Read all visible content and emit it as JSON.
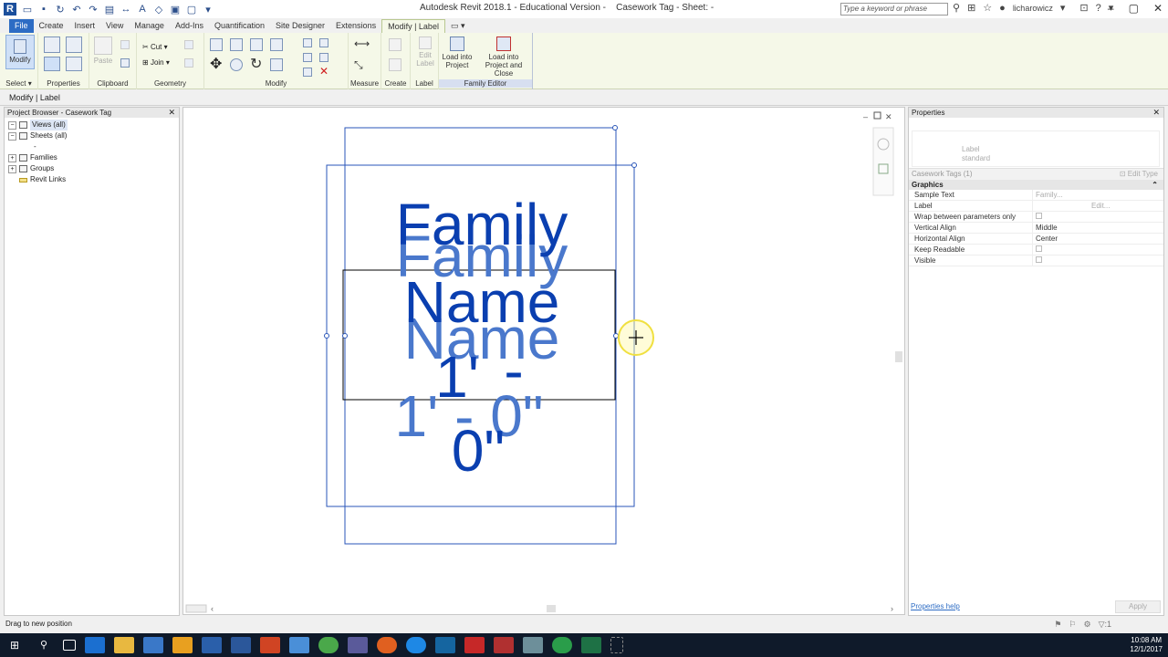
{
  "title_bar": {
    "app_title": "Autodesk Revit 2018.1 - Educational Version -",
    "doc_title": "Casework Tag - Sheet: -",
    "search_placeholder": "Type a keyword or phrase",
    "user": "licharowicz"
  },
  "tabs": [
    "File",
    "Create",
    "Insert",
    "View",
    "Manage",
    "Add-Ins",
    "Quantification",
    "Site Designer",
    "Extensions",
    "Modify | Label"
  ],
  "ribbon": {
    "panels": {
      "select": "Select",
      "properties": "Properties",
      "clipboard": "Clipboard",
      "geometry": "Geometry",
      "modify": "Modify",
      "measure": "Measure",
      "create": "Create",
      "label": "Label",
      "family_editor": "Family Editor"
    },
    "buttons": {
      "modify": "Modify",
      "paste": "Paste",
      "cut": "Cut",
      "join": "Join",
      "edit_label_1": "Edit",
      "edit_label_2": "Label",
      "load_project_1": "Load into",
      "load_project_2": "Project",
      "load_close_1": "Load into",
      "load_close_2": "Project and Close"
    }
  },
  "options_bar": {
    "context": "Modify | Label"
  },
  "project_browser": {
    "title": "Project Browser - Casework Tag",
    "items": [
      {
        "label": "Views (all)",
        "level": 0,
        "toggle": "−"
      },
      {
        "label": "Sheets (all)",
        "level": 0,
        "toggle": "−"
      },
      {
        "label": "-",
        "level": 1,
        "toggle": ""
      },
      {
        "label": "Families",
        "level": 0,
        "toggle": "+"
      },
      {
        "label": "Groups",
        "level": 0,
        "toggle": "+"
      },
      {
        "label": "Revit Links",
        "level": 0,
        "toggle": ""
      }
    ]
  },
  "canvas": {
    "label_text": {
      "line1": "Family",
      "line2": "Name",
      "line3": "1'",
      "line4": "-",
      "line5": "0\""
    },
    "ghost_text": {
      "line1": "Family",
      "line2": "Name",
      "line3": "1' - 0\""
    }
  },
  "properties": {
    "title": "Properties",
    "type_name_line1": "Label",
    "type_name_line2": "standard",
    "instance": "Casework Tags (1)",
    "edit_type": "Edit Type",
    "group": "Graphics",
    "rows": [
      {
        "key": "Sample Text",
        "value": "Family..."
      },
      {
        "key": "Label",
        "value": "Edit..."
      },
      {
        "key": "Wrap between parameters only",
        "value": ""
      },
      {
        "key": "Vertical Align",
        "value": "Middle"
      },
      {
        "key": "Horizontal Align",
        "value": "Center"
      },
      {
        "key": "Keep Readable",
        "value": ""
      },
      {
        "key": "Visible",
        "value": ""
      }
    ],
    "help_link": "Properties help",
    "apply": "Apply"
  },
  "status_bar": {
    "message": "Drag to new position",
    "counter": ":1"
  },
  "taskbar": {
    "time": "10:08 AM",
    "date": "12/1/2017"
  },
  "colors": {
    "accent": "#2d6cc4",
    "label_blue": "#0a3fb0",
    "label_ghost": "#4a78cc",
    "ribbon_bg": "#f5f8e8"
  }
}
